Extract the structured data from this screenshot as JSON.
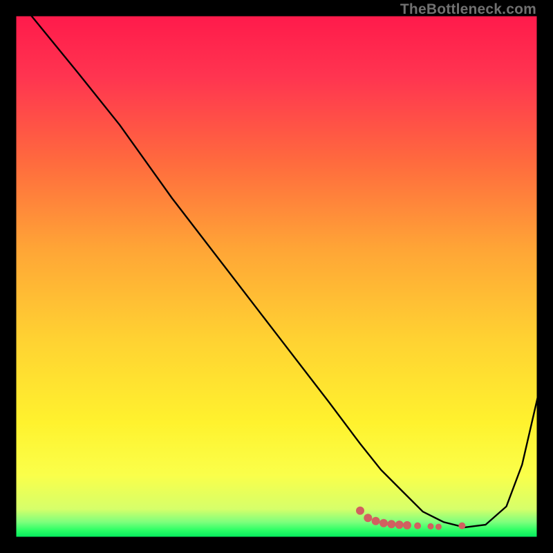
{
  "watermark": "TheBottleneck.com",
  "gradient": {
    "stops": [
      {
        "offset": 0.0,
        "color": "#ff1a4b"
      },
      {
        "offset": 0.12,
        "color": "#ff3550"
      },
      {
        "offset": 0.28,
        "color": "#ff6a3e"
      },
      {
        "offset": 0.45,
        "color": "#ffa636"
      },
      {
        "offset": 0.62,
        "color": "#ffd232"
      },
      {
        "offset": 0.78,
        "color": "#fff22e"
      },
      {
        "offset": 0.88,
        "color": "#faff4a"
      },
      {
        "offset": 0.945,
        "color": "#d6ff6a"
      },
      {
        "offset": 0.97,
        "color": "#7dff7d"
      },
      {
        "offset": 0.985,
        "color": "#2eff66"
      },
      {
        "offset": 1.0,
        "color": "#00e85e"
      }
    ]
  },
  "chart_data": {
    "type": "line",
    "title": "",
    "xlabel": "",
    "ylabel": "",
    "xlim": [
      0,
      100
    ],
    "ylim": [
      0,
      100
    ],
    "series": [
      {
        "name": "curve",
        "x": [
          3,
          12,
          20,
          30,
          40,
          50,
          60,
          66,
          70,
          74,
          78,
          82,
          86,
          90,
          94,
          97,
          100
        ],
        "y": [
          100,
          89,
          79,
          65,
          52,
          39,
          26,
          18,
          13,
          9,
          5,
          3,
          2,
          2.5,
          6,
          14,
          27
        ]
      }
    ],
    "markers": {
      "name": "highlight-dots",
      "color": "#d16060",
      "points": [
        {
          "x": 66,
          "y": 5.2,
          "r": 6
        },
        {
          "x": 67.5,
          "y": 3.8,
          "r": 6
        },
        {
          "x": 69,
          "y": 3.2,
          "r": 6
        },
        {
          "x": 70.5,
          "y": 2.8,
          "r": 6
        },
        {
          "x": 72,
          "y": 2.6,
          "r": 6
        },
        {
          "x": 73.5,
          "y": 2.5,
          "r": 6
        },
        {
          "x": 75,
          "y": 2.4,
          "r": 6
        },
        {
          "x": 77,
          "y": 2.3,
          "r": 5
        },
        {
          "x": 79.5,
          "y": 2.2,
          "r": 4.5
        },
        {
          "x": 81,
          "y": 2.1,
          "r": 4.5
        },
        {
          "x": 85.5,
          "y": 2.3,
          "r": 5
        }
      ]
    }
  }
}
